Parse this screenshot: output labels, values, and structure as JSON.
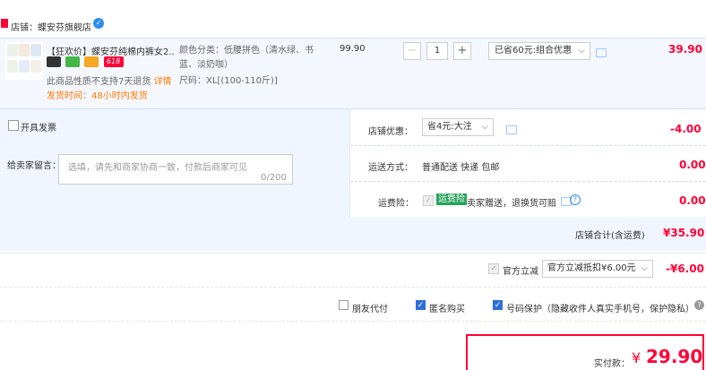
{
  "store": {
    "label": "店铺：蝶安芬旗舰店",
    "badge": "✓"
  },
  "product": {
    "title": "【狂欢价】蝶安芬纯棉内裤女2...",
    "badge_618": "618",
    "notice_a": "此商品性质不支持7天退货",
    "notice_b": "详情",
    "ship": "发货时间：48小时内发货",
    "spec_color": "颜色分类：低腰拼色（清水绿、书蓝、淡奶咖）",
    "spec_size": "尺码：XL[(100-110斤)]",
    "price": "99.90",
    "qty": "1",
    "qty_minus": "−",
    "qty_plus": "+",
    "promo": "已省60元:组合优惠",
    "subtotal": "39.90"
  },
  "invoice": {
    "label": "开具发票"
  },
  "shop_promo": {
    "label": "店铺优惠：",
    "option": "省4元:大注",
    "value": "-4.00"
  },
  "delivery": {
    "label": "运送方式：",
    "value": "普通配送 快递 包邮",
    "price": "0.00"
  },
  "insurance": {
    "label": "运费险：",
    "badge": "运费险",
    "text": "卖家赠送，退换货可赔",
    "price": "0.00"
  },
  "message": {
    "label": "给卖家留言：",
    "placeholder": "选填，请先和商家协商一致，付款后商家可见",
    "count": "0/200"
  },
  "shop_total": {
    "label": "店铺合计(含运费)",
    "value": "¥35.90"
  },
  "guanfang": {
    "label": "官方立减",
    "option": "官方立减抵扣¥6.00元",
    "value": "-¥6.00"
  },
  "options": {
    "friend_pay": "朋友代付",
    "anonymous": "匿名购买",
    "privacy": "号码保护（隐藏收件人真实手机号，保护隐私）"
  },
  "payment": {
    "label": "实付款：",
    "symbol": "¥",
    "value": "29.90"
  },
  "colors": {
    "accent": "#ff0036",
    "orange": "#ff7a00",
    "panel": "#f0f5ff"
  },
  "icons": [
    "store-icon",
    "verified-icon",
    "chevron-down-icon",
    "message-icon",
    "help-icon",
    "checkbox-icon"
  ]
}
